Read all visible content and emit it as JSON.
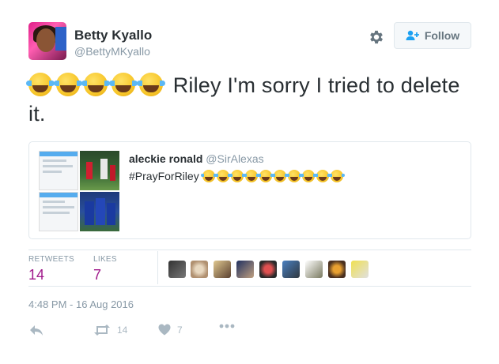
{
  "author": {
    "name": "Betty Kyallo",
    "handle": "@BettyMKyallo"
  },
  "follow_label": "Follow",
  "tweet": {
    "text": "Riley I'm sorry I tried to delete it.",
    "emoji_count": 5
  },
  "quoted": {
    "name": "aleckie ronald",
    "handle": "@SirAlexas",
    "text": "#PrayForRiley",
    "emoji_count": 10
  },
  "stats": {
    "retweets_label": "RETWEETS",
    "retweets": "14",
    "likes_label": "LIKES",
    "likes": "7"
  },
  "timestamp": "4:48 PM - 16 Aug 2016",
  "actions": {
    "retweet_count": "14",
    "like_count": "7"
  },
  "colors": {
    "stat": "#a0198b",
    "muted": "#8899a6",
    "border": "#e1e8ed"
  },
  "icons": [
    "gear-icon",
    "follow-person-icon",
    "reply-icon",
    "retweet-icon",
    "heart-icon",
    "more-icon"
  ]
}
